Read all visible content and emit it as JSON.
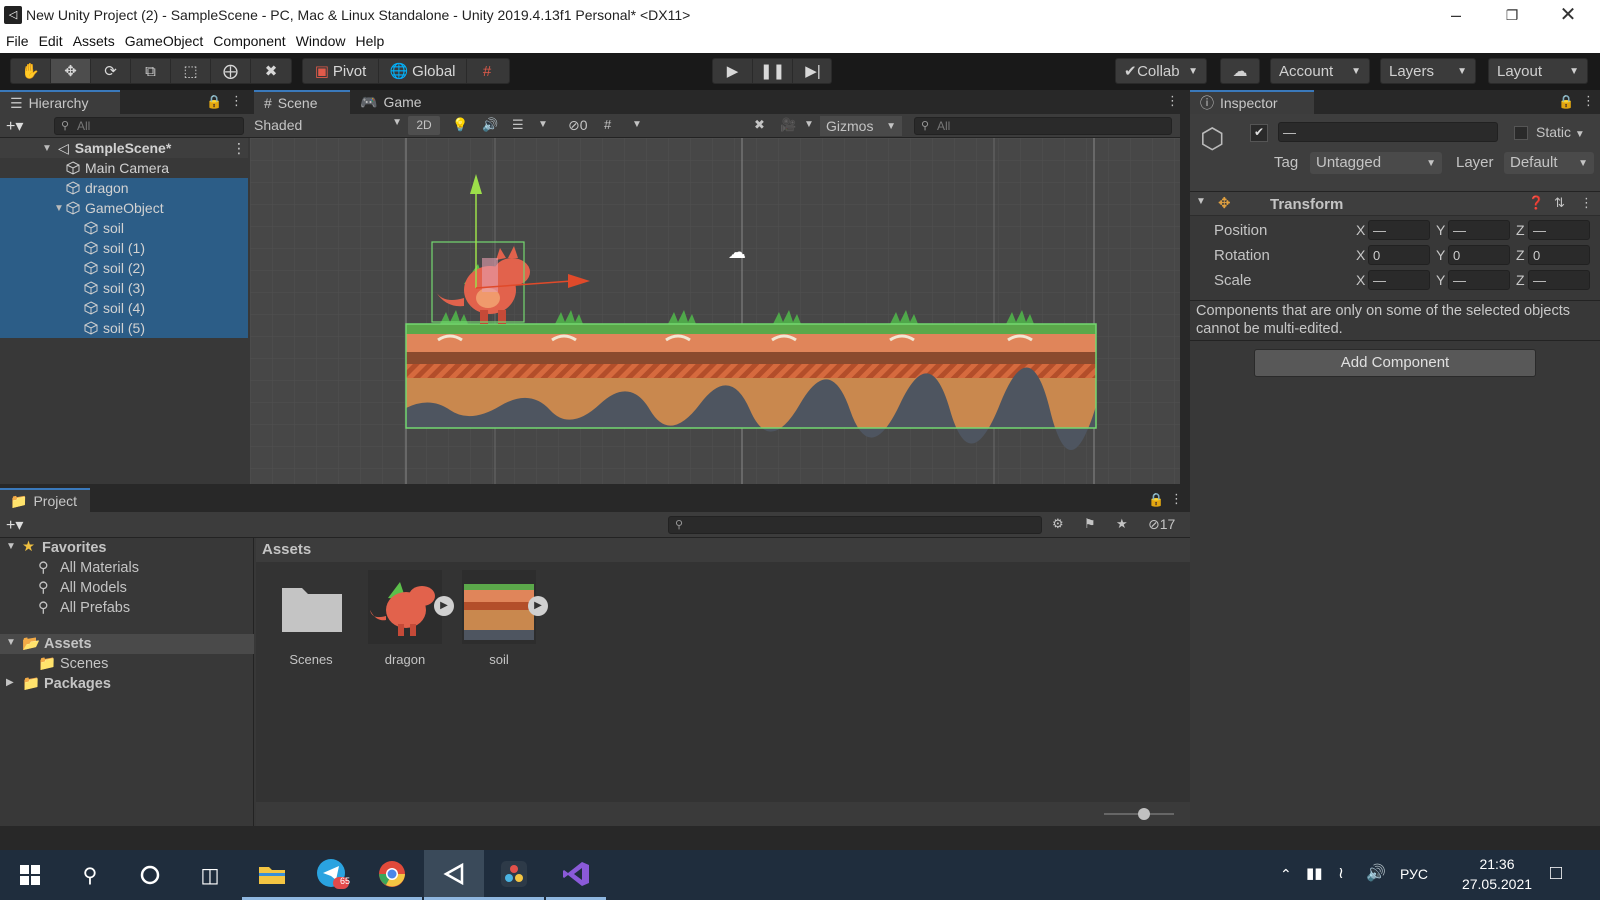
{
  "window": {
    "title": "New Unity Project (2) - SampleScene - PC, Mac & Linux Standalone - Unity 2019.4.13f1 Personal* <DX11>",
    "controls": [
      "minimize-icon",
      "restore-icon",
      "close-icon"
    ]
  },
  "menu": [
    "File",
    "Edit",
    "Assets",
    "GameObject",
    "Component",
    "Window",
    "Help"
  ],
  "toolbar": {
    "tools": [
      "hand-tool-icon",
      "move-tool-icon",
      "rotate-tool-icon",
      "scale-tool-icon",
      "rect-tool-icon",
      "transform-tool-icon",
      "custom-tool-icon"
    ],
    "active_tool": "move-tool-icon",
    "pivot": "Pivot",
    "global": "Global",
    "collab": "Collab",
    "account": "Account",
    "layers": "Layers",
    "layout": "Layout"
  },
  "hierarchy": {
    "tab": "Hierarchy",
    "search_placeholder": "All",
    "scene": "SampleScene*",
    "items": [
      {
        "label": "Main Camera",
        "depth": 1,
        "selected": false
      },
      {
        "label": "dragon",
        "depth": 1,
        "selected": true
      },
      {
        "label": "GameObject",
        "depth": 1,
        "selected": true,
        "expanded": true
      },
      {
        "label": "soil",
        "depth": 2,
        "selected": true
      },
      {
        "label": "soil (1)",
        "depth": 2,
        "selected": true
      },
      {
        "label": "soil (2)",
        "depth": 2,
        "selected": true
      },
      {
        "label": "soil (3)",
        "depth": 2,
        "selected": true
      },
      {
        "label": "soil (4)",
        "depth": 2,
        "selected": true
      },
      {
        "label": "soil (5)",
        "depth": 2,
        "selected": true
      }
    ]
  },
  "scene": {
    "tab_scene": "Scene",
    "tab_game": "Game",
    "shading": "Shaded",
    "mode_2d": "2D",
    "hidden_count": "0",
    "gizmos": "Gizmos",
    "search_placeholder": "All"
  },
  "inspector": {
    "tab": "Inspector",
    "name_value": "—",
    "static_label": "Static",
    "tag_label": "Tag",
    "tag_value": "Untagged",
    "layer_label": "Layer",
    "layer_value": "Default",
    "component": "Transform",
    "rows": [
      {
        "label": "Position",
        "x": "—",
        "y": "—",
        "z": "—"
      },
      {
        "label": "Rotation",
        "x": "0",
        "y": "0",
        "z": "0"
      },
      {
        "label": "Scale",
        "x": "—",
        "y": "—",
        "z": "—"
      }
    ],
    "axis_labels": [
      "X",
      "Y",
      "Z"
    ],
    "note": "Components that are only on some of the selected objects cannot be multi-edited.",
    "add_component": "Add Component"
  },
  "project": {
    "tab": "Project",
    "hidden_count": "17",
    "favorites": "Favorites",
    "fav_items": [
      "All Materials",
      "All Models",
      "All Prefabs"
    ],
    "assets_root": "Assets",
    "assets_children": [
      "Scenes"
    ],
    "packages": "Packages",
    "breadcrumb": "Assets",
    "assets": [
      {
        "label": "Scenes",
        "kind": "folder"
      },
      {
        "label": "dragon",
        "kind": "sprite"
      },
      {
        "label": "soil",
        "kind": "sprite"
      }
    ]
  },
  "taskbar": {
    "apps": [
      "start-icon",
      "search-icon",
      "cortana-icon",
      "task-view-icon",
      "file-explorer-icon",
      "telegram-icon",
      "chrome-icon",
      "unity-icon",
      "davinci-icon",
      "visual-studio-icon"
    ],
    "telegram_badge": "65",
    "language": "РУС",
    "time": "21:36",
    "date": "27.05.2021"
  }
}
